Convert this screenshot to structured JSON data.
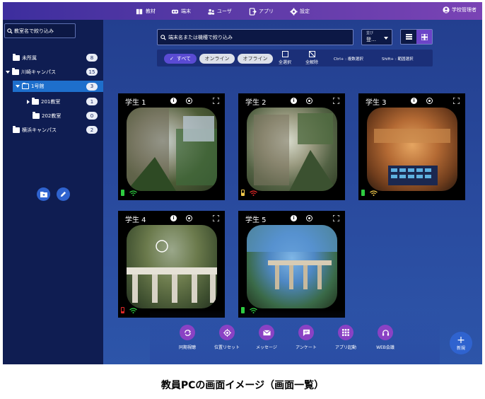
{
  "nav": {
    "items": [
      {
        "label": "教材",
        "icon": "book-icon"
      },
      {
        "label": "端末",
        "icon": "vr-headset-icon"
      },
      {
        "label": "ユーザ",
        "icon": "users-icon"
      },
      {
        "label": "アプリ",
        "icon": "app-icon"
      },
      {
        "label": "設定",
        "icon": "gear-icon"
      }
    ],
    "account": "学校管理者"
  },
  "sidebar": {
    "search_placeholder": "教室名で絞り込み",
    "tree": [
      {
        "label": "未所属",
        "count": "8"
      },
      {
        "label": "川崎キャンパス",
        "count": "15"
      },
      {
        "label": "1号館",
        "count": "3"
      },
      {
        "label": "201教室",
        "count": "1"
      },
      {
        "label": "202教室",
        "count": "0"
      },
      {
        "label": "横浜キャンパス",
        "count": "2"
      }
    ]
  },
  "toolbar": {
    "search_placeholder": "端末名または機種で絞り込み",
    "sort_label": "並び",
    "sort_value": "登…"
  },
  "filters": {
    "all": "すべて",
    "online": "オンライン",
    "offline": "オフライン",
    "select_all": "全選択",
    "deselect_all": "全解除",
    "hint_multi": "Ctrl+ : 複数選択",
    "hint_range": "Shift+ : 範囲選択"
  },
  "devices": [
    {
      "name": "学生 1",
      "battery_color": "#2ecc40",
      "wifi_color": "#2ecc40"
    },
    {
      "name": "学生 2",
      "battery_color": "#f2c94c",
      "wifi_color": "#e02828"
    },
    {
      "name": "学生 3",
      "battery_color": "#2ecc40",
      "wifi_color": "#f2c94c"
    },
    {
      "name": "学生 4",
      "battery_color": "#e02828",
      "wifi_color": "#2ecc40"
    },
    {
      "name": "学生 5",
      "battery_color": "#2ecc40",
      "wifi_color": "#2ecc40"
    }
  ],
  "actions": [
    {
      "label": "同期視聴",
      "icon": "sync-icon"
    },
    {
      "label": "位置リセット",
      "icon": "target-icon"
    },
    {
      "label": "メッセージ",
      "icon": "mail-icon"
    },
    {
      "label": "アンケート",
      "icon": "chat-icon"
    },
    {
      "label": "アプリ起動",
      "icon": "grid-icon"
    },
    {
      "label": "WEB会議",
      "icon": "headset-icon"
    }
  ],
  "new_button": "新規",
  "caption": "教員PCの画面イメージ（画面一覧）",
  "colors": {
    "topbar_start": "#3d2e9e",
    "topbar_end": "#7a43b5",
    "sidebar": "#0f1d52",
    "selected": "#1e6fcc",
    "action": "#8a42c4"
  }
}
